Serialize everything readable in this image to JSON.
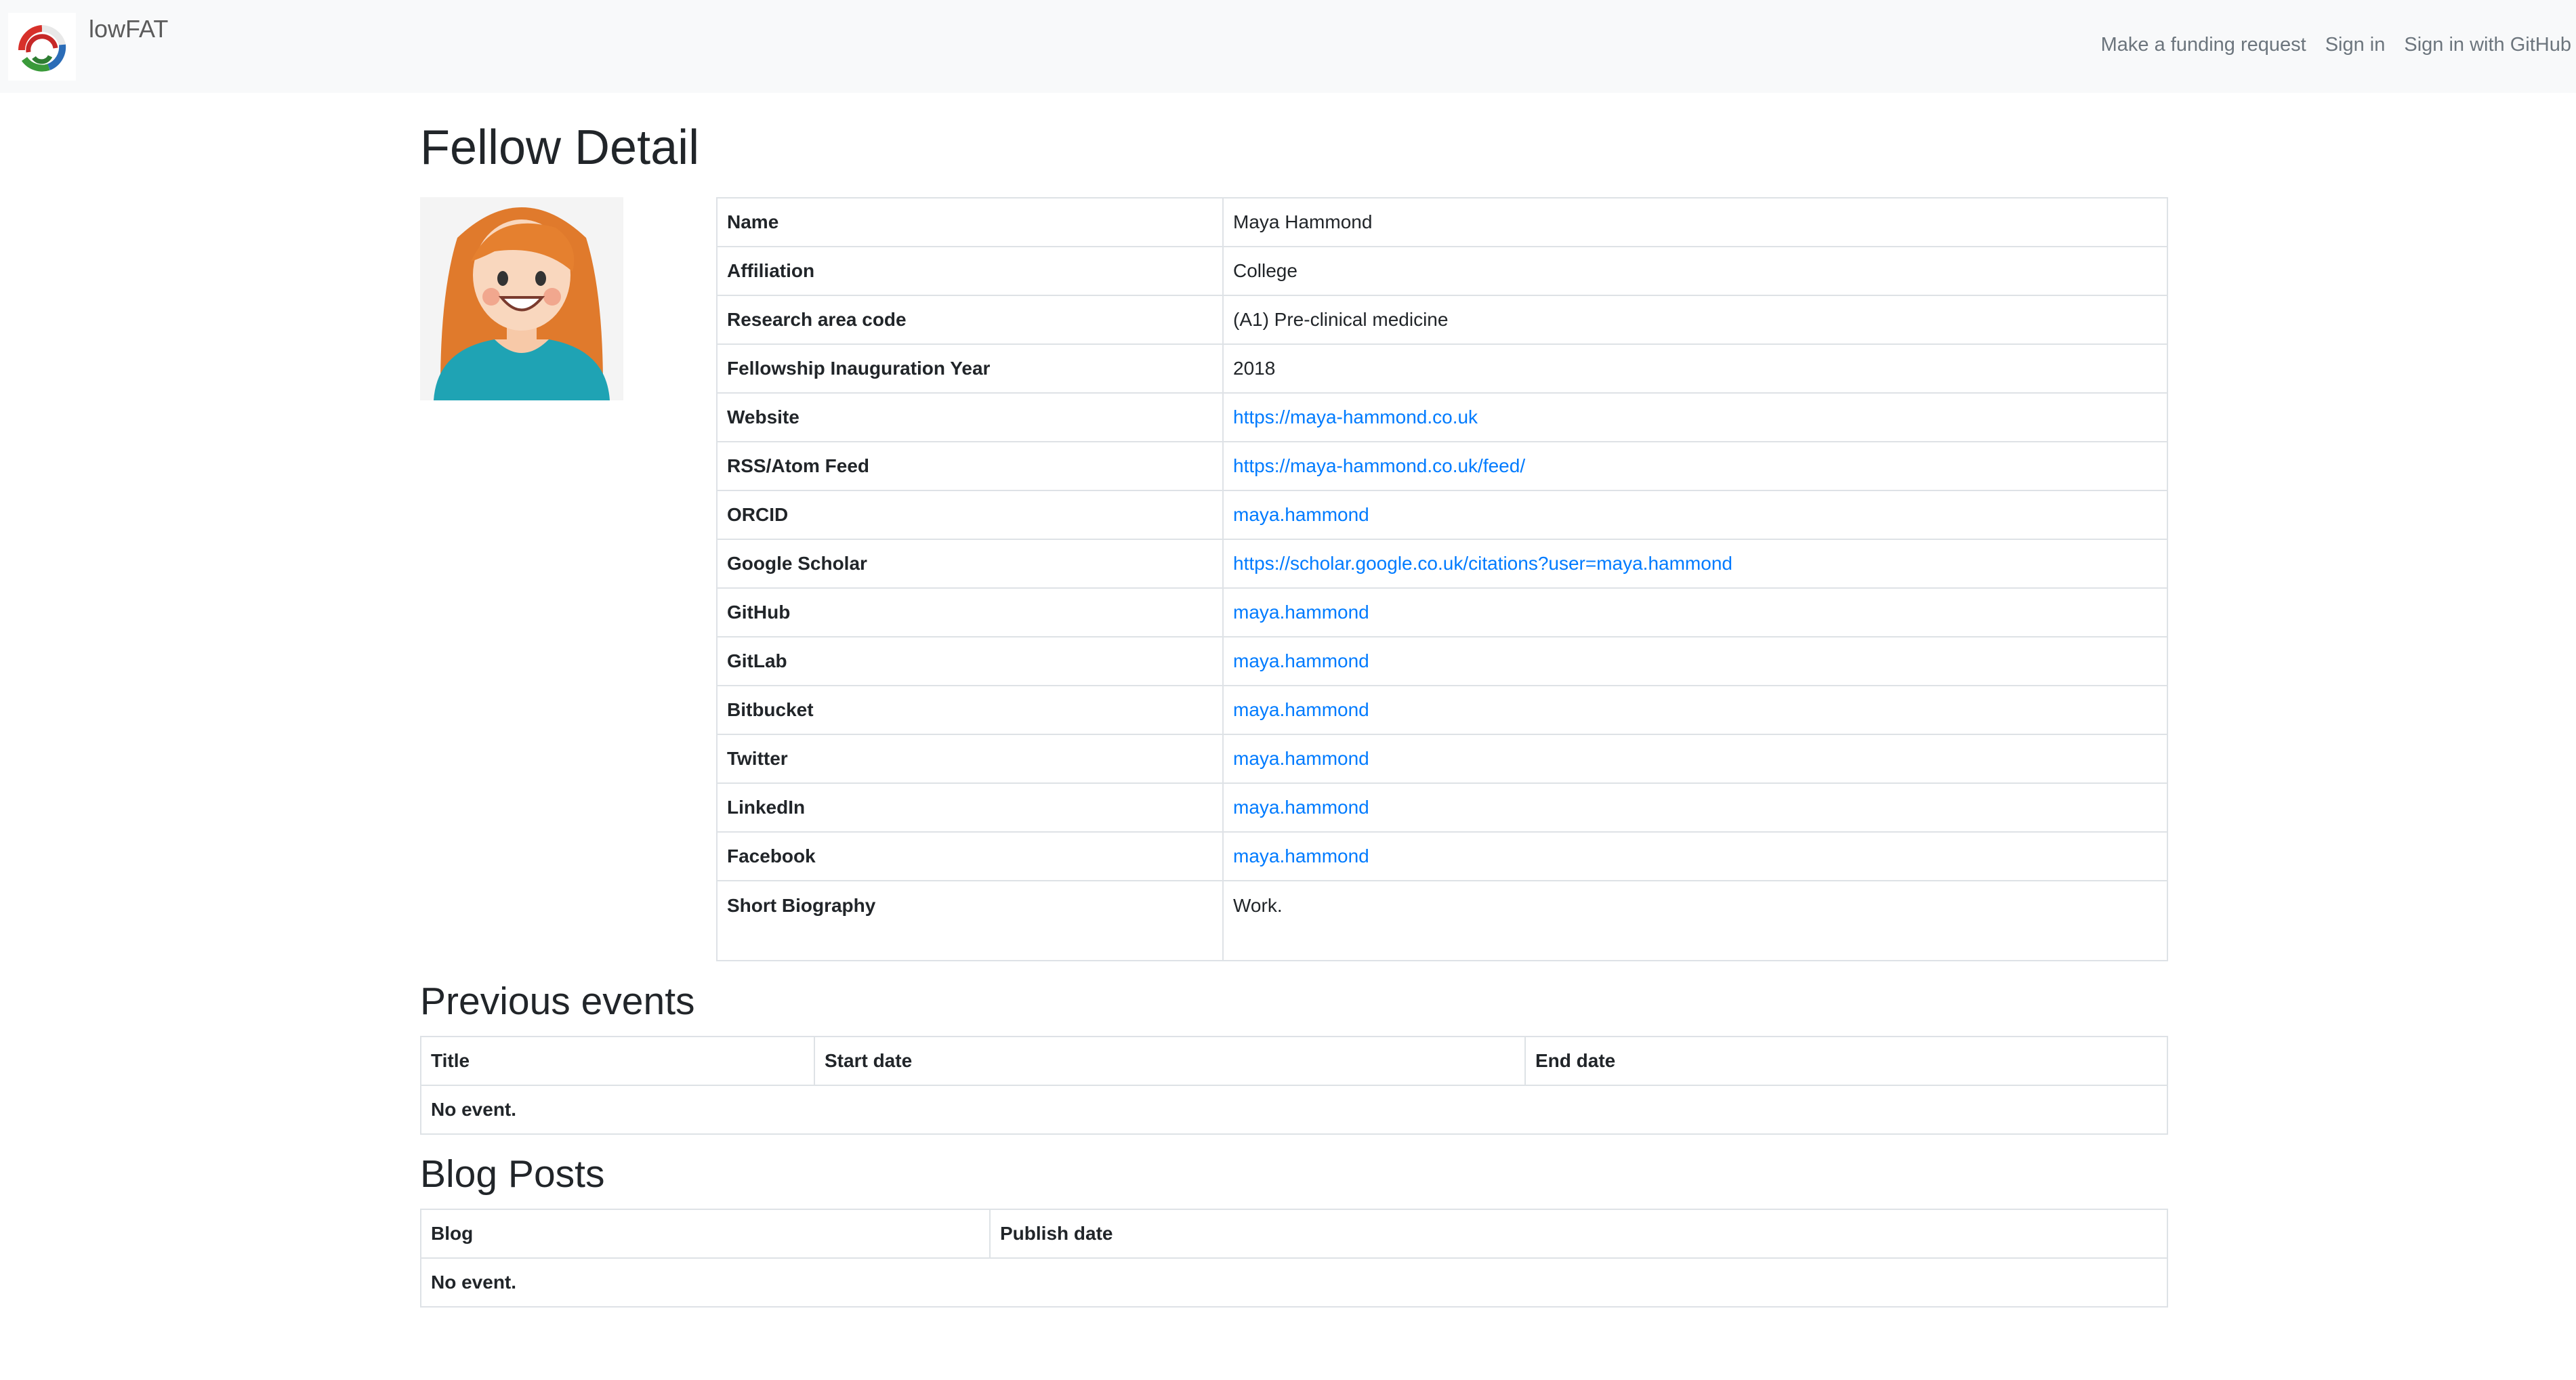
{
  "navbar": {
    "brand": "lowFAT",
    "links": [
      "Make a funding request",
      "Sign in",
      "Sign in with GitHub"
    ]
  },
  "page": {
    "title": "Fellow Detail"
  },
  "fellow": {
    "rows": [
      {
        "label": "Name",
        "value": "Maya Hammond"
      },
      {
        "label": "Affiliation",
        "value": "College"
      },
      {
        "label": "Research area code",
        "value": "(A1) Pre-clinical medicine"
      },
      {
        "label": "Fellowship Inauguration Year",
        "value": "2018"
      },
      {
        "label": "Website",
        "value": "https://maya-hammond.co.uk"
      },
      {
        "label": "RSS/Atom Feed",
        "value": "https://maya-hammond.co.uk/feed/"
      },
      {
        "label": "ORCID",
        "value": "maya.hammond"
      },
      {
        "label": "Google Scholar",
        "value": "https://scholar.google.co.uk/citations?user=maya.hammond"
      },
      {
        "label": "GitHub",
        "value": "maya.hammond"
      },
      {
        "label": "GitLab",
        "value": "maya.hammond"
      },
      {
        "label": "Bitbucket",
        "value": "maya.hammond"
      },
      {
        "label": "Twitter",
        "value": "maya.hammond"
      },
      {
        "label": "LinkedIn",
        "value": "maya.hammond"
      },
      {
        "label": "Facebook",
        "value": "maya.hammond"
      },
      {
        "label": "Short Biography",
        "value": "Work."
      }
    ]
  },
  "previous_events": {
    "heading": "Previous events",
    "columns": [
      "Title",
      "Start date",
      "End date"
    ],
    "empty": "No event."
  },
  "blog_posts": {
    "heading": "Blog Posts",
    "columns": [
      "Blog",
      "Publish date"
    ],
    "empty": "No event."
  },
  "colors": {
    "link": "#007bff",
    "navbar_bg": "#f8f9fa",
    "border": "#dee2e6"
  }
}
